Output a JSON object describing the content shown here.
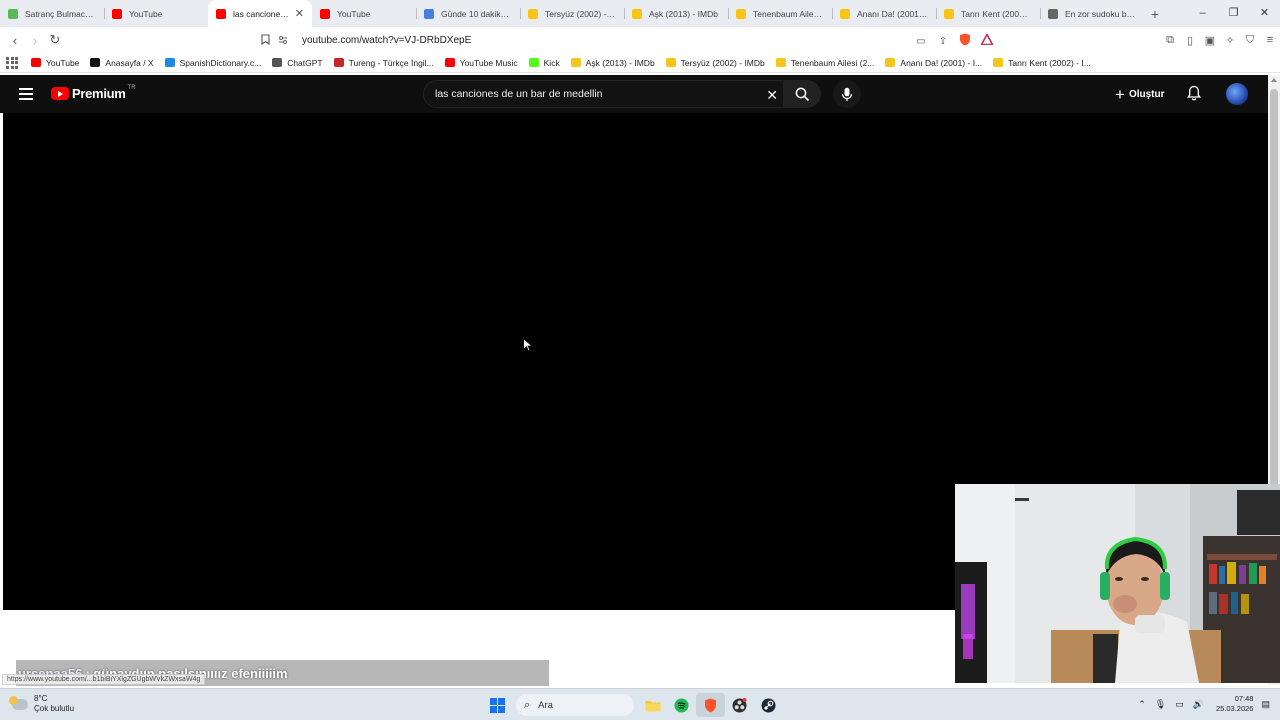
{
  "browser": {
    "tabs": [
      {
        "title": "Satranç Bulmacaları",
        "color": "#5cb85c",
        "active": false
      },
      {
        "title": "YouTube",
        "color": "#ff0000",
        "active": false
      },
      {
        "title": "las canciones de un bar",
        "color": "#ff0000",
        "active": true
      },
      {
        "title": "YouTube",
        "color": "#ff0000",
        "active": false
      },
      {
        "title": "Günde 10 dakikada",
        "color": "#4a7fe0",
        "active": false
      },
      {
        "title": "Tersyüz (2002) - IMDb",
        "color": "#f5c518",
        "active": false
      },
      {
        "title": "Aşk (2013) - IMDb",
        "color": "#f5c518",
        "active": false
      },
      {
        "title": "Tenenbaum Ailesi (2",
        "color": "#f5c518",
        "active": false
      },
      {
        "title": "Ananı Da! (2001) - I",
        "color": "#f5c518",
        "active": false
      },
      {
        "title": "Tanrı Kent (2002) - I",
        "color": "#f5c518",
        "active": false
      },
      {
        "title": "En zor sudoku bulm",
        "color": "#666666",
        "active": false
      }
    ],
    "new_tab": "+",
    "window_controls": {
      "minimize": "–",
      "restore": "❐",
      "close": "✕"
    },
    "url": "youtube.com/watch?v=VJ-DRbDXepE",
    "bookmarks": [
      {
        "label": "YouTube",
        "color": "#ff0000"
      },
      {
        "label": "Anasayfa / X",
        "color": "#111111"
      },
      {
        "label": "SpanishDictionary.c...",
        "color": "#1e88e5"
      },
      {
        "label": "ChatGPT",
        "color": "#555555"
      },
      {
        "label": "Tureng - Türkçe İngil...",
        "color": "#c62828"
      },
      {
        "label": "YouTube Music",
        "color": "#ff0000"
      },
      {
        "label": "Kick",
        "color": "#53fc18"
      },
      {
        "label": "Aşk (2013) - IMDb",
        "color": "#f5c518"
      },
      {
        "label": "Tersyüz (2002) - IMDb",
        "color": "#f5c518"
      },
      {
        "label": "Tenenbaum Ailesi (2...",
        "color": "#f5c518"
      },
      {
        "label": "Ananı Da! (2001) - I...",
        "color": "#f5c518"
      },
      {
        "label": "Tanrı Kent (2002) - I...",
        "color": "#f5c518"
      }
    ]
  },
  "youtube": {
    "logo_text": "Premium",
    "country_code": "TR",
    "search_value": "las canciones de un bar de medellin",
    "create_label": "Oluştur"
  },
  "overlay": {
    "chat_user": "ursenaa56",
    "chat_message": ": günaydıın nasılsınıııız efeniiiiim",
    "status_url": "https://www.youtube.com/...b1biBiYXlgZGUgbWVkZWxsaW4g"
  },
  "taskbar": {
    "temperature": "8°C",
    "weather": "Çok bulutlu",
    "search_placeholder": "Ara",
    "time": "07:48",
    "date": "25.03.2026"
  },
  "colors": {
    "youtube_bg": "#0f0f0f",
    "youtube_red": "#ff0000",
    "taskbar_bg": "#dde6ed"
  }
}
